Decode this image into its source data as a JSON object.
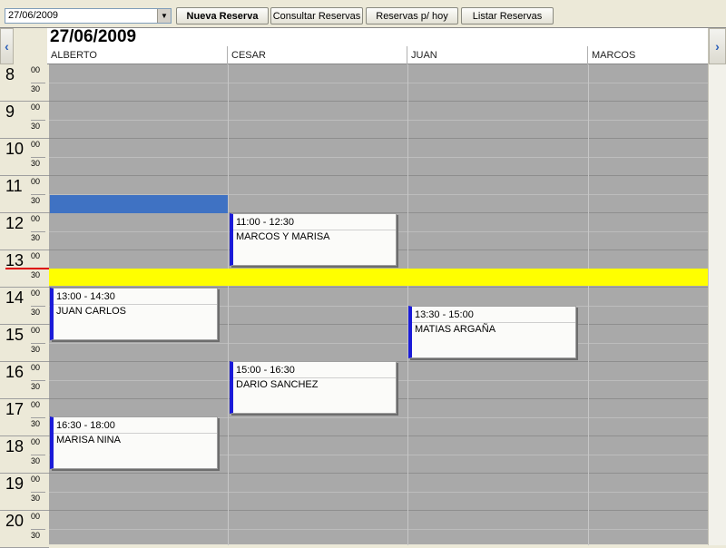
{
  "toolbar": {
    "date_value": "27/06/2009",
    "buttons": [
      "Nueva Reserva",
      "Consultar Reservas",
      "Reservas p/ hoy",
      "Listar Reservas"
    ]
  },
  "calendar": {
    "date_title": "27/06/2009",
    "resources": [
      "ALBERTO",
      "CESAR",
      "JUAN",
      "MARCOS"
    ],
    "hours": [
      "8",
      "9",
      "10",
      "11",
      "12",
      "13",
      "14",
      "15",
      "16",
      "17",
      "18",
      "19",
      "20"
    ],
    "minute_labels": {
      "top": "00",
      "half": "30"
    },
    "appointments": [
      {
        "time": "11:00 - 12:30",
        "name": "MARCOS Y MARISA"
      },
      {
        "time": "13:00 - 14:30",
        "name": "JUAN CARLOS"
      },
      {
        "time": "13:30 - 15:00",
        "name": "MATIAS ARGAÑA"
      },
      {
        "time": "15:00 - 16:30",
        "name": "DARIO SANCHEZ"
      },
      {
        "time": "16:30 - 18:00",
        "name": "MARISA NINA"
      }
    ]
  },
  "colors": {
    "selection": "#3f72c3",
    "current_time_band": "#ffff00",
    "appointment_accent": "#1b1bd8",
    "now_marker": "#dd0000"
  },
  "icons": [
    "chevron-down-icon",
    "chevron-left-icon",
    "chevron-right-icon"
  ]
}
